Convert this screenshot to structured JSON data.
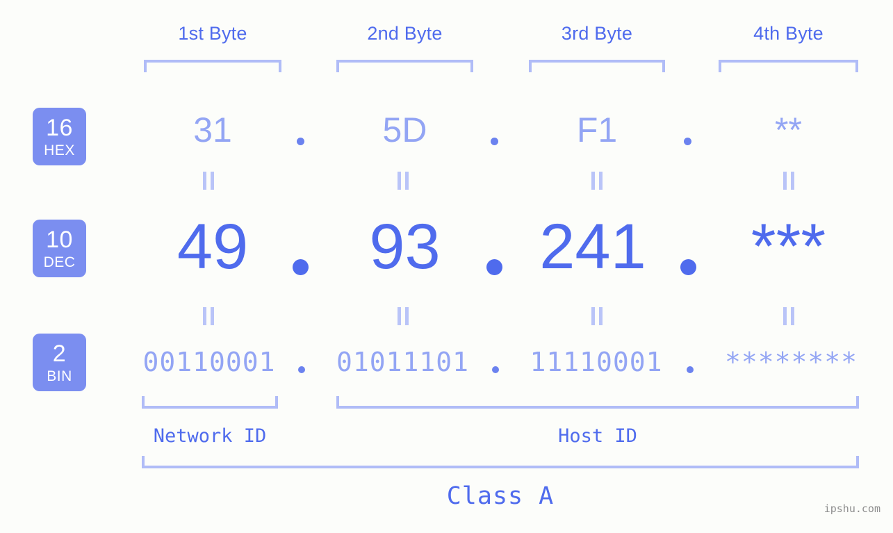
{
  "background_color": "#fcfdfa",
  "accent_color": "#4f6bed",
  "accent_light_color": "#93a5f4",
  "bracket_color": "#b0bcf7",
  "badge_color": "#7b8ef0",
  "header": {
    "byte_labels": [
      "1st Byte",
      "2nd Byte",
      "3rd Byte",
      "4th Byte"
    ]
  },
  "radix_badges": [
    {
      "number": "16",
      "name": "HEX"
    },
    {
      "number": "10",
      "name": "DEC"
    },
    {
      "number": "2",
      "name": "BIN"
    }
  ],
  "rows": {
    "hex": {
      "radix": "16",
      "label": "HEX",
      "values": [
        "31",
        "5D",
        "F1",
        "**"
      ],
      "separator": "."
    },
    "dec": {
      "radix": "10",
      "label": "DEC",
      "values": [
        "49",
        "93",
        "241",
        "***"
      ],
      "separator": "."
    },
    "bin": {
      "radix": "2",
      "label": "BIN",
      "values": [
        "00110001",
        "01011101",
        "11110001",
        "********"
      ],
      "separator": "."
    }
  },
  "equality_marks": {
    "glyph": "||",
    "count_per_row": 4,
    "rows": 2
  },
  "footer": {
    "network_id_label": "Network ID",
    "host_id_label": "Host ID",
    "class_label": "Class A"
  },
  "watermark": "ipshu.com"
}
